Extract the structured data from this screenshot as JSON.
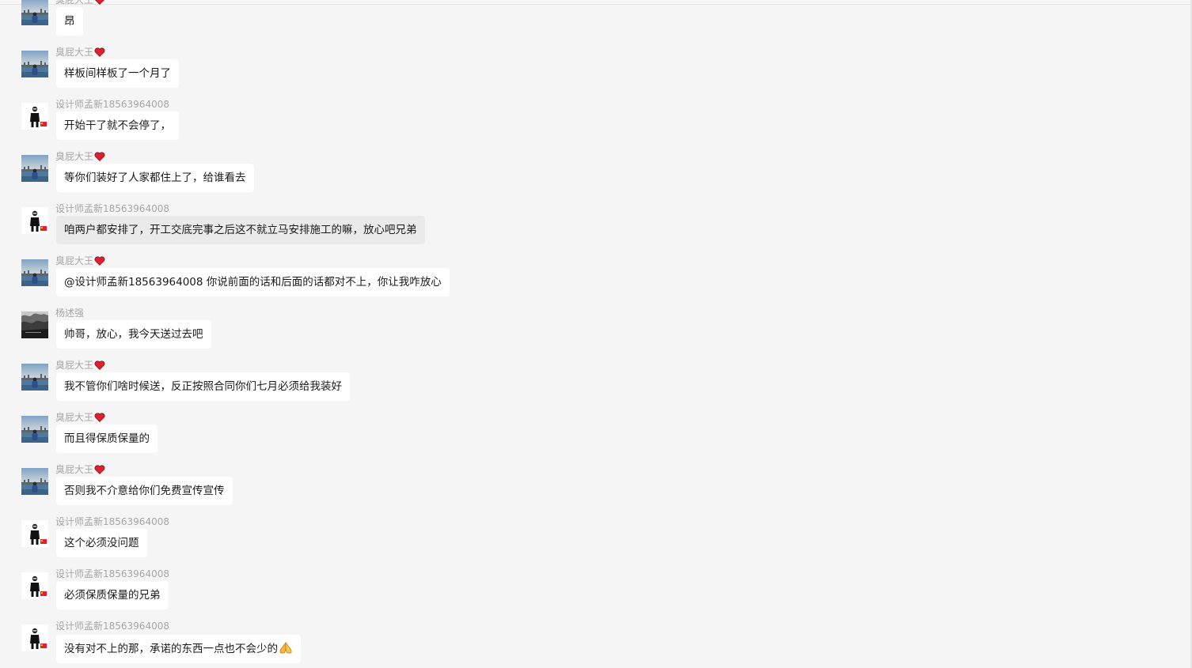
{
  "window": {
    "title": ""
  },
  "senders": {
    "chouPi": "臭屁大王",
    "designer": "设计师孟新18563964008",
    "yang": "杨述强"
  },
  "colors": {
    "background": "#f5f5f5",
    "bubble": "#ffffff",
    "bubble_selected": "#eaeaea",
    "sender_name": "#a6a6a6",
    "heart": "#e0202f"
  },
  "messages": [
    {
      "sender": "臭屁大王",
      "heart": true,
      "avatar": "harbor-photo-avatar",
      "text": "昂"
    },
    {
      "sender": "臭屁大王",
      "heart": true,
      "avatar": "harbor-photo-avatar",
      "text": "样板间样板了一个月了"
    },
    {
      "sender": "设计师孟新18563964008",
      "heart": false,
      "avatar": "designer-person-avatar",
      "text": "开始干了就不会停了，"
    },
    {
      "sender": "臭屁大王",
      "heart": true,
      "avatar": "harbor-photo-avatar",
      "text": "等你们装好了人家都住上了，给谁看去"
    },
    {
      "sender": "设计师孟新18563964008",
      "heart": false,
      "avatar": "designer-person-avatar",
      "text": "咱两户都安排了，开工交底完事之后这不就立马安排施工的嘛，放心吧兄弟",
      "selected": true
    },
    {
      "sender": "臭屁大王",
      "heart": true,
      "avatar": "harbor-photo-avatar",
      "text": "@设计师孟新18563964008 你说前面的话和后面的话都对不上，你让我咋放心"
    },
    {
      "sender": "杨述强",
      "heart": false,
      "avatar": "dark-landscape-avatar",
      "text": "帅哥，放心，我今天送过去吧"
    },
    {
      "sender": "臭屁大王",
      "heart": true,
      "avatar": "harbor-photo-avatar",
      "text": "我不管你们啥时候送，反正按照合同你们七月必须给我装好"
    },
    {
      "sender": "臭屁大王",
      "heart": true,
      "avatar": "harbor-photo-avatar",
      "text": "而且得保质保量的"
    },
    {
      "sender": "臭屁大王",
      "heart": true,
      "avatar": "harbor-photo-avatar",
      "text": "否则我不介意给你们免费宣传宣传"
    },
    {
      "sender": "设计师孟新18563964008",
      "heart": false,
      "avatar": "designer-person-avatar",
      "text": "这个必须没问题"
    },
    {
      "sender": "设计师孟新18563964008",
      "heart": false,
      "avatar": "designer-person-avatar",
      "text": "必须保质保量的兄弟"
    },
    {
      "sender": "设计师孟新18563964008",
      "heart": false,
      "avatar": "designer-person-avatar",
      "text": "没有对不上的那，承诺的东西一点也不会少的",
      "emoji": "pray-hands-icon"
    }
  ]
}
